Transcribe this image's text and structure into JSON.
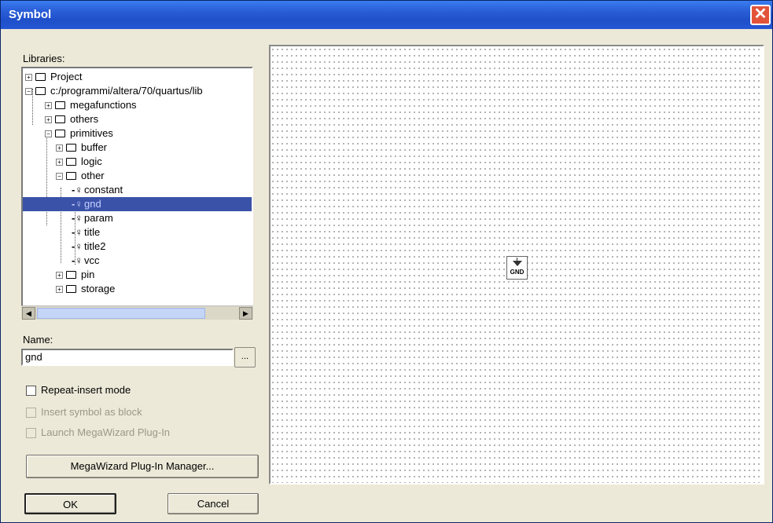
{
  "window": {
    "title": "Symbol",
    "close_icon": "close-icon"
  },
  "libraries": {
    "label": "Libraries:",
    "tree": [
      {
        "label": "Project",
        "icon": "folder-icon"
      },
      {
        "label": "c:/programmi/altera/70/quartus/lib",
        "icon": "folder-open-icon"
      },
      {
        "label": "megafunctions",
        "icon": "folder-icon"
      },
      {
        "label": "others",
        "icon": "folder-icon"
      },
      {
        "label": "primitives",
        "icon": "folder-open-icon"
      },
      {
        "label": "buffer",
        "icon": "folder-icon"
      },
      {
        "label": "logic",
        "icon": "folder-icon"
      },
      {
        "label": "other",
        "icon": "folder-open-icon"
      },
      {
        "label": "constant",
        "icon": "symbol-icon"
      },
      {
        "label": "gnd",
        "icon": "symbol-icon",
        "selected": true
      },
      {
        "label": "param",
        "icon": "symbol-icon"
      },
      {
        "label": "title",
        "icon": "symbol-icon"
      },
      {
        "label": "title2",
        "icon": "symbol-icon"
      },
      {
        "label": "vcc",
        "icon": "symbol-icon"
      },
      {
        "label": "pin",
        "icon": "folder-icon"
      },
      {
        "label": "storage",
        "icon": "folder-icon"
      }
    ]
  },
  "name": {
    "label": "Name:",
    "value": "gnd",
    "browse_label": "..."
  },
  "options": {
    "repeat_insert": "Repeat-insert mode",
    "insert_as_block": "Insert symbol as block",
    "launch_megawizard": "Launch MegaWizard Plug-In"
  },
  "buttons": {
    "megawizard_manager": "MegaWizard Plug-In Manager...",
    "ok": "OK",
    "cancel": "Cancel"
  },
  "preview": {
    "symbol_text": "GND"
  },
  "colors": {
    "titlebar": "#2a5fd8",
    "selection": "#3a52a8",
    "dialog_bg": "#ece9d8"
  }
}
